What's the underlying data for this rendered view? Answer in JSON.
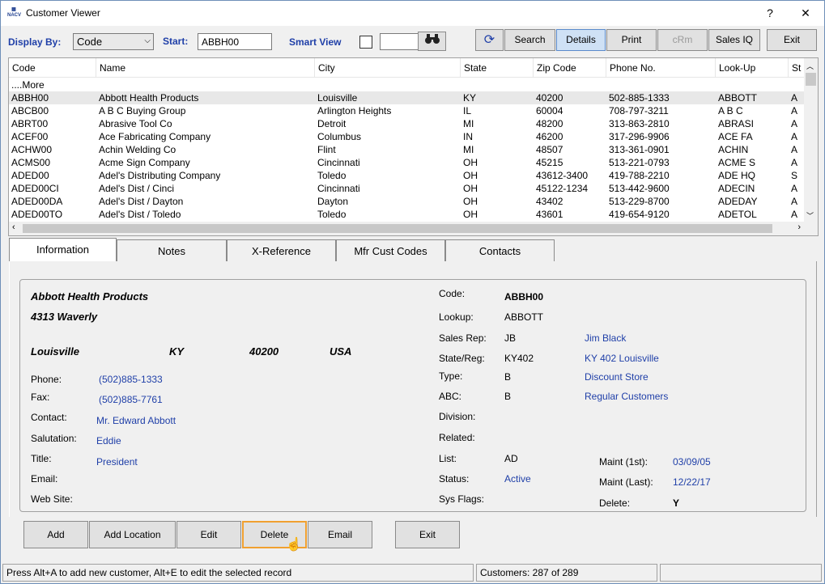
{
  "window": {
    "title": "Customer Viewer",
    "help_label": "?",
    "close_label": "✕"
  },
  "toolbar": {
    "display_by_label": "Display By:",
    "display_by_value": "Code",
    "start_label": "Start:",
    "start_value": "ABBH00",
    "smart_view_label": "Smart View",
    "search_label": "Search",
    "details_label": "Details",
    "print_label": "Print",
    "crm_label": "cRm",
    "sales_iq_label": "Sales IQ",
    "exit_label": "Exit"
  },
  "grid": {
    "columns": [
      "Code",
      "Name",
      "City",
      "State",
      "Zip Code",
      "Phone No.",
      "Look-Up",
      "St"
    ],
    "more_label": "....More",
    "rows": [
      [
        "ABBH00",
        "Abbott Health Products",
        "Louisville",
        "KY",
        "40200",
        "502-885-1333",
        "ABBOTT",
        "A"
      ],
      [
        "ABCB00",
        "A B C Buying Group",
        "Arlington Heights",
        "IL",
        "60004",
        "708-797-3211",
        "A B C",
        "A"
      ],
      [
        "ABRT00",
        "Abrasive Tool Co",
        "Detroit",
        "MI",
        "48200",
        "313-863-2810",
        "ABRASI",
        "A"
      ],
      [
        "ACEF00",
        "Ace Fabricating Company",
        "Columbus",
        "IN",
        "46200",
        "317-296-9906",
        "ACE FA",
        "A"
      ],
      [
        "ACHW00",
        "Achin Welding Co",
        "Flint",
        "MI",
        "48507",
        "313-361-0901",
        "ACHIN",
        "A"
      ],
      [
        "ACMS00",
        "Acme Sign Company",
        "Cincinnati",
        "OH",
        "45215",
        "513-221-0793",
        "ACME S",
        "A"
      ],
      [
        "ADED00",
        "Adel's Distributing Company",
        "Toledo",
        "OH",
        "43612-3400",
        "419-788-2210",
        "ADE HQ",
        "S"
      ],
      [
        "ADED00CI",
        "Adel's Dist / Cinci",
        "Cincinnati",
        "OH",
        "45122-1234",
        "513-442-9600",
        "ADECIN",
        "A"
      ],
      [
        "ADED00DA",
        "Adel's Dist / Dayton",
        "Dayton",
        "OH",
        "43402",
        "513-229-8700",
        "ADEDAY",
        "A"
      ],
      [
        "ADED00TO",
        "Adel's Dist / Toledo",
        "Toledo",
        "OH",
        "43601",
        "419-654-9120",
        "ADETOL",
        "A"
      ]
    ]
  },
  "tabs": [
    "Information",
    "Notes",
    "X-Reference",
    "Mfr Cust Codes",
    "Contacts"
  ],
  "info": {
    "company": "Abbott Health Products",
    "address": "4313 Waverly",
    "city": "Louisville",
    "state": "KY",
    "zip": "40200",
    "country": "USA",
    "phone_label": "Phone:",
    "phone": "(502)885-1333",
    "fax_label": "Fax:",
    "fax": "(502)885-7761",
    "contact_label": "Contact:",
    "contact": "Mr. Edward Abbott",
    "salutation_label": "Salutation:",
    "salutation": "Eddie",
    "title_label": "Title:",
    "title": "President",
    "email_label": "Email:",
    "website_label": "Web Site:",
    "code_label": "Code:",
    "code": "ABBH00",
    "lookup_label": "Lookup:",
    "lookup": "ABBOTT",
    "salesrep_label": "Sales Rep:",
    "salesrep_code": "JB",
    "salesrep_name": "Jim Black",
    "statereg_label": "State/Reg:",
    "statereg_code": "KY402",
    "statereg_name": "KY 402 Louisville",
    "type_label": "Type:",
    "type_code": "B",
    "type_name": "Discount Store",
    "abc_label": "ABC:",
    "abc_code": "B",
    "abc_name": "Regular Customers",
    "division_label": "Division:",
    "related_label": "Related:",
    "list_label": "List:",
    "list": "AD",
    "status_label": "Status:",
    "status": "Active",
    "sysflags_label": "Sys Flags:",
    "maint1_label": "Maint (1st):",
    "maint1": "03/09/05",
    "maintlast_label": "Maint (Last):",
    "maintlast": "12/22/17",
    "delete_label": "Delete:",
    "delete": "Y"
  },
  "actions": {
    "add": "Add",
    "add_location": "Add Location",
    "edit": "Edit",
    "delete": "Delete",
    "email": "Email",
    "exit": "Exit"
  },
  "status": {
    "hint": "Press Alt+A to add new customer,  Alt+E to edit the selected record",
    "count": "Customers: 287 of 289"
  }
}
